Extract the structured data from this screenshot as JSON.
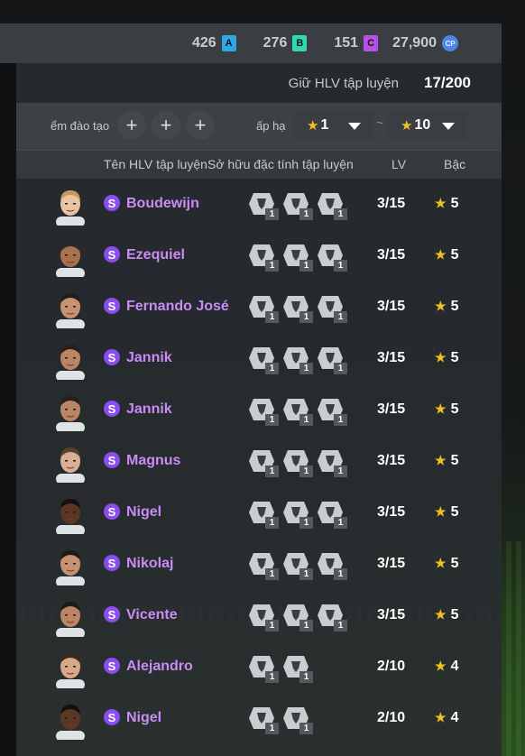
{
  "currencies": [
    {
      "value": "426",
      "badge": "A",
      "color": "#2fa6e6"
    },
    {
      "value": "276",
      "badge": "B",
      "color": "#2fd7b0"
    },
    {
      "value": "151",
      "badge": "C",
      "color": "#b650e8"
    },
    {
      "value": "27,900",
      "badge": "CP",
      "color": "#4f86e6"
    }
  ],
  "hold": {
    "label": "Giữ HLV tập luyện",
    "value": "17/200"
  },
  "filters": {
    "training_label": "ểm đào tạo",
    "rank_label": "ấp hạ",
    "rank_from": "1",
    "rank_to": "10",
    "separator": "~"
  },
  "columns": {
    "name": "Tên HLV tập luyện",
    "traits": "Sở hữu đặc tính tập luyện",
    "lv": "LV",
    "grade": "Bậc"
  },
  "coaches": [
    {
      "name": "Boudewijn",
      "traits": [
        "trait-a-icon",
        "trait-b-icon",
        "trait-c-icon"
      ],
      "lv": "3/15",
      "grade": "5",
      "skin": "#e8c4a6",
      "hair": "#c79a5a"
    },
    {
      "name": "Ezequiel",
      "traits": [
        "trait-d-icon",
        "trait-e-icon",
        "trait-c-icon"
      ],
      "lv": "3/15",
      "grade": "5",
      "skin": "#a8724e",
      "hair": "#2a2a2a"
    },
    {
      "name": "Fernando José",
      "traits": [
        "trait-d-icon",
        "trait-f-icon",
        "trait-g-icon"
      ],
      "lv": "3/15",
      "grade": "5",
      "skin": "#c79272",
      "hair": "#1e1e1e"
    },
    {
      "name": "Jannik",
      "traits": [
        "trait-h-icon",
        "trait-i-icon",
        "trait-c-icon"
      ],
      "lv": "3/15",
      "grade": "5",
      "skin": "#b98564",
      "hair": "#2a1f18"
    },
    {
      "name": "Jannik",
      "traits": [
        "trait-d-icon",
        "trait-e-icon",
        "trait-b-icon"
      ],
      "lv": "3/15",
      "grade": "5",
      "skin": "#b98564",
      "hair": "#2a1f18"
    },
    {
      "name": "Magnus",
      "traits": [
        "trait-d-icon",
        "trait-f-icon",
        "trait-c-icon"
      ],
      "lv": "3/15",
      "grade": "5",
      "skin": "#d8b095",
      "hair": "#5a4030"
    },
    {
      "name": "Nigel",
      "traits": [
        "trait-j-icon",
        "trait-b-icon",
        "trait-k-icon"
      ],
      "lv": "3/15",
      "grade": "5",
      "skin": "#5a3624",
      "hair": "#141010"
    },
    {
      "name": "Nikolaj",
      "traits": [
        "trait-a-icon",
        "trait-l-icon",
        "trait-b-icon"
      ],
      "lv": "3/15",
      "grade": "5",
      "skin": "#c79272",
      "hair": "#1e1a16"
    },
    {
      "name": "Vicente",
      "traits": [
        "trait-d-icon",
        "trait-a-icon",
        "trait-m-icon"
      ],
      "lv": "3/15",
      "grade": "5",
      "skin": "#b98564",
      "hair": "#1e1a16"
    },
    {
      "name": "Alejandro",
      "traits": [
        "trait-d-icon",
        "trait-n-icon"
      ],
      "lv": "2/10",
      "grade": "4",
      "skin": "#d8a888",
      "hair": "#3a2a1e"
    },
    {
      "name": "Nigel",
      "traits": [
        "trait-j-icon",
        "trait-o-icon"
      ],
      "lv": "2/10",
      "grade": "4",
      "skin": "#5a3624",
      "hair": "#141010"
    }
  ],
  "trait_level": "1"
}
